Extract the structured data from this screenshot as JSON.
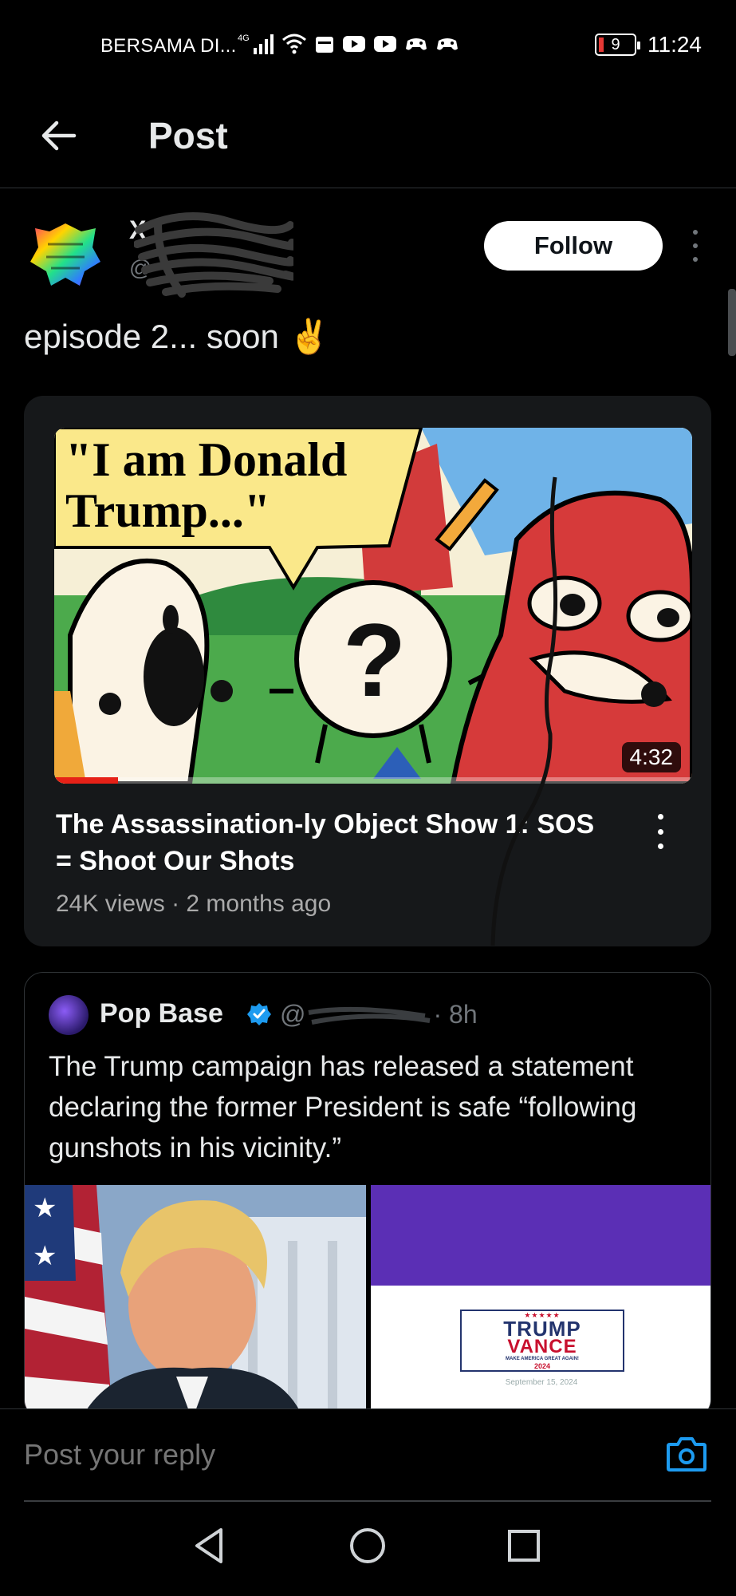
{
  "status_bar": {
    "carrier": "BERSAMA DI...",
    "network": "4G",
    "battery_level": "9",
    "time": "11:24"
  },
  "header": {
    "title": "Post"
  },
  "post": {
    "author_name": "X",
    "author_handle": "@",
    "follow_label": "Follow",
    "text": "episode 2... soon ✌️",
    "video": {
      "thumbnail_caption": "\"I am Donald Trump...\"",
      "duration": "4:32",
      "watch_progress": 0.1,
      "title": "The Assassination-ly Object Show 1: SOS = Shoot Our Shots",
      "meta": "24K views · 2 months ago"
    }
  },
  "quoted_post": {
    "author_name": "Pop Base",
    "author_handle": "@",
    "time": "· 8h",
    "text": "The Trump campaign has released a statement declaring the former President is safe “following gunshots in his vicinity.”",
    "image2": {
      "line1": "TRUMP",
      "line2": "VANCE",
      "slogan": "MAKE AMERICA GREAT AGAIN!",
      "year": "2024",
      "date": "September 15, 2024"
    }
  },
  "reply": {
    "placeholder": "Post your reply"
  },
  "colors": {
    "background": "#000000",
    "text_primary": "#e7e9ea",
    "text_secondary": "#71767b",
    "accent": "#1d9bf0",
    "progress_red": "#e62117"
  }
}
